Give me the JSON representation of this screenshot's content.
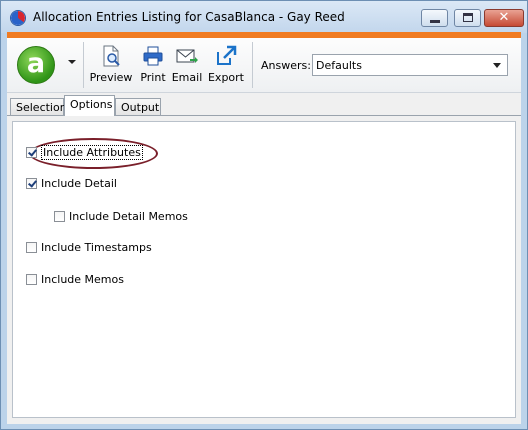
{
  "window": {
    "title": "Allocation Entries Listing for CasaBlanca - Gay Reed",
    "accent_color": "#f07b22",
    "close_glyph": "✕"
  },
  "toolbar": {
    "logo_letter": "a",
    "buttons": [
      {
        "label": "Preview",
        "icon": "preview-icon"
      },
      {
        "label": "Print",
        "icon": "printer-icon"
      },
      {
        "label": "Email",
        "icon": "envelope-icon"
      },
      {
        "label": "Export",
        "icon": "export-icon"
      }
    ],
    "answers_label": "Answers:",
    "answers_value": "Defaults"
  },
  "tabs": [
    {
      "label": "Selection"
    },
    {
      "label": "Options",
      "active": true
    },
    {
      "label": "Output"
    }
  ],
  "options": [
    {
      "label": "Include Attributes",
      "checked": true,
      "focused": true,
      "highlighted": true
    },
    {
      "label": "Include Detail",
      "checked": true
    },
    {
      "label": "Include Detail Memos",
      "checked": false
    },
    {
      "label": "Include Timestamps",
      "checked": false
    },
    {
      "label": "Include Memos",
      "checked": false
    }
  ]
}
